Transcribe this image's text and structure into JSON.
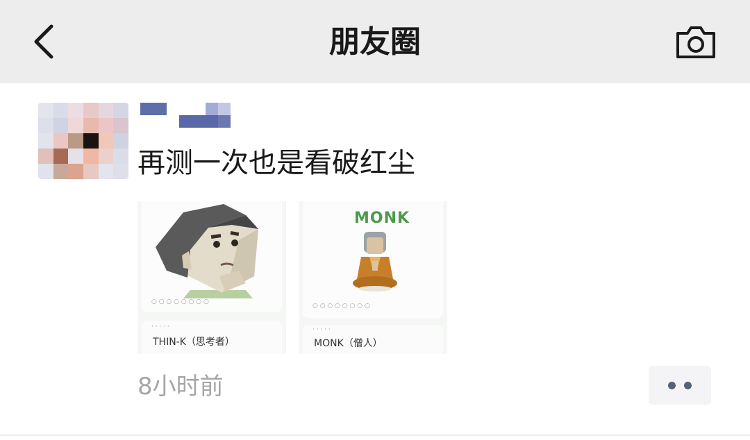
{
  "nav": {
    "title": "朋友圈",
    "back_icon": "chevron-left-icon",
    "camera_icon": "camera-icon"
  },
  "post": {
    "text": "再测一次也是看破红尘",
    "time": "8小时前",
    "more_icon": "more-dots-icon",
    "images": [
      {
        "type_name": "THIN-K（思考者）"
      },
      {
        "heading": "MONK",
        "type_name": "MONK（僧人）"
      }
    ]
  },
  "colors": {
    "nav_background": "#ededed",
    "text_primary": "#191919",
    "timestamp": "#a6a6a6",
    "more_dots": "#56617a",
    "monk_heading": "#4c9a4c"
  }
}
